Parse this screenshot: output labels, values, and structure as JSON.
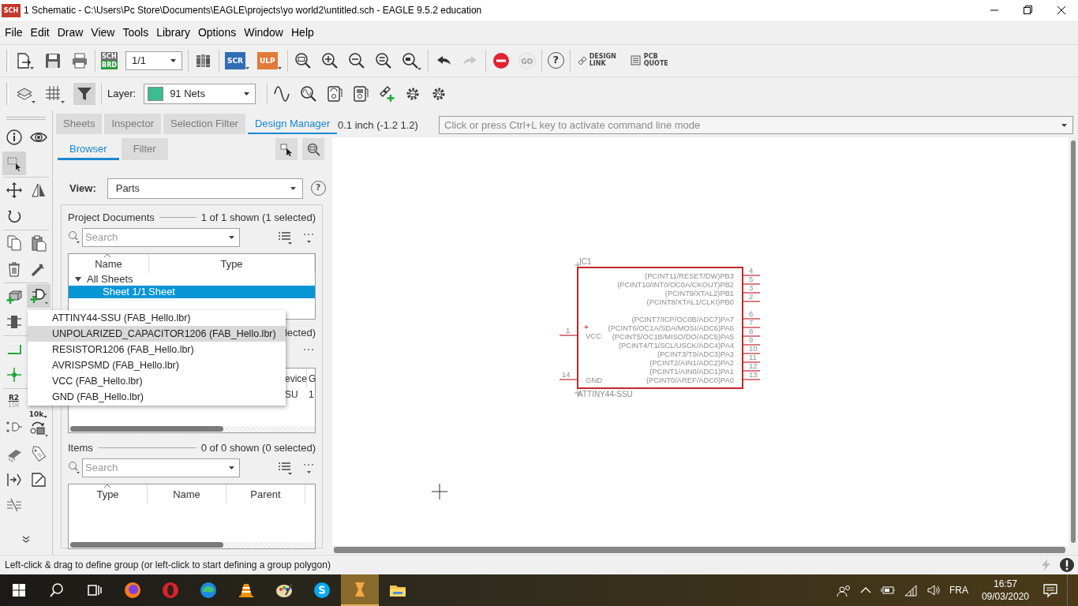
{
  "window": {
    "title": "1 Schematic - C:\\Users\\Pc Store\\Documents\\EAGLE\\projects\\yo world2\\untitled.sch - EAGLE 9.5.2 education",
    "app_badge": "SCH"
  },
  "menu": [
    "File",
    "Edit",
    "Draw",
    "View",
    "Tools",
    "Library",
    "Options",
    "Window",
    "Help"
  ],
  "toolbar": {
    "sch_brd": [
      "SCH",
      "BRD"
    ],
    "brd_highlighted": true,
    "sheet": "1/1",
    "scr": "SCR",
    "ulp": "ULP",
    "redo_disabled": true,
    "go": {
      "label": "GO",
      "disabled": true
    },
    "help": "?",
    "design_link": [
      "DESIGN",
      "LINK"
    ],
    "pcb_quote": [
      "PCB",
      "QUOTE"
    ]
  },
  "layer_toolbar": {
    "filter_selected": true,
    "label": "Layer:",
    "layer": "91 Nets",
    "color": "#3dbd8f"
  },
  "left_toolbar": {
    "select_selected": true,
    "add_selected": true,
    "name_label": "R2",
    "name_value": "10k",
    "value_label": "10k"
  },
  "panel": {
    "tabs": [
      {
        "label": "Sheets",
        "selected": false
      },
      {
        "label": "Inspector",
        "selected": false
      },
      {
        "label": "Selection Filter",
        "selected": false
      },
      {
        "label": "Design Manager",
        "selected": true
      }
    ],
    "subtabs": [
      {
        "label": "Browser",
        "selected": true
      },
      {
        "label": "Filter",
        "selected": false
      }
    ],
    "view_label": "View:",
    "view": "Parts",
    "help": "?",
    "project_documents": {
      "title": "Project Documents",
      "count": "1 of 1 shown (1 selected)",
      "search_placeholder": "Search",
      "columns": [
        "Name",
        "Type"
      ],
      "tree": [
        {
          "label": "All Sheets",
          "expanded": true,
          "children": [
            {
              "name": "Sheet 1/1",
              "type": "Sheet",
              "selected": true
            }
          ]
        }
      ]
    },
    "parts": {
      "count": "lected)",
      "columns": [
        "evice",
        "G"
      ],
      "rows": [
        [
          "SU",
          "1"
        ]
      ]
    },
    "items": {
      "title": "Items",
      "count": "0 of 0 shown (0 selected)",
      "search_placeholder": "Search",
      "columns": [
        "Type",
        "Name",
        "Parent"
      ]
    }
  },
  "add_menu": [
    {
      "label": "ATTINY44-SSU (FAB_Hello.lbr)",
      "selected": false
    },
    {
      "label": "UNPOLARIZED_CAPACITOR1206 (FAB_Hello.lbr)",
      "selected": true
    },
    {
      "label": "RESISTOR1206 (FAB_Hello.lbr)",
      "selected": false
    },
    {
      "label": "AVRISPSMD (FAB_Hello.lbr)",
      "selected": false
    },
    {
      "label": "VCC (FAB_Hello.lbr)",
      "selected": false
    },
    {
      "label": "GND (FAB_Hello.lbr)",
      "selected": false
    }
  ],
  "command_bar": {
    "grid": "0.1 inch (-1.2 1.2)",
    "placeholder": "Click or press Ctrl+L key to activate command line mode"
  },
  "schematic": {
    "name": "IC1",
    "value": "ATTINY44-SSU",
    "left_pins": [
      {
        "number": "1",
        "label": "VCC",
        "polarity": "+"
      },
      {
        "number": "14",
        "label": "GND"
      }
    ],
    "right_pin_groups": [
      [
        {
          "number": "4",
          "label": "(PCINT11/RESET/DW)PB3"
        },
        {
          "number": "5",
          "label": "(PCINT10/INT0/OC0A/CKOUT)PB2"
        },
        {
          "number": "3",
          "label": "(PCINT9/XTAL2)PB1"
        },
        {
          "number": "2",
          "label": "(PCINT8/XTAL1/CLKI)PB0"
        }
      ],
      [
        {
          "number": "6",
          "label": "(PCINT7/ICP/OC0B/ADC7)PA7"
        },
        {
          "number": "7",
          "label": "(PCINT6/OC1A/SDA/MOSI/ADC6)PA6"
        },
        {
          "number": "8",
          "label": "(PCINT5/OC1B/MISO/DO/ADC5)PA5"
        },
        {
          "number": "9",
          "label": "(PCINT4/T1/SCL/USCK/ADC4)PA4"
        },
        {
          "number": "10",
          "label": "(PCINT3/T0/ADC3)PA3"
        },
        {
          "number": "11",
          "label": "(PCINT2/AIN1/ADC2)PA2"
        },
        {
          "number": "12",
          "label": "(PCINT1/AIN0/ADC1)PA1"
        },
        {
          "number": "13",
          "label": "(PCINT0/AREF/ADC0)PA0"
        }
      ]
    ]
  },
  "status_bar": {
    "message": "Left-click & drag to define group (or left-click to start defining a group polygon)"
  },
  "taskbar": {
    "apps": [
      {
        "kind": "firefox",
        "selected": false
      },
      {
        "kind": "opera",
        "selected": false
      },
      {
        "kind": "edge",
        "selected": false
      },
      {
        "kind": "vlc",
        "selected": false
      },
      {
        "kind": "paint",
        "selected": false
      },
      {
        "kind": "skype",
        "selected": false
      },
      {
        "kind": "eagle",
        "selected": true
      },
      {
        "kind": "explorer",
        "selected": false
      }
    ],
    "language": "FRA",
    "time": "16:57",
    "date": "09/03/2020"
  }
}
